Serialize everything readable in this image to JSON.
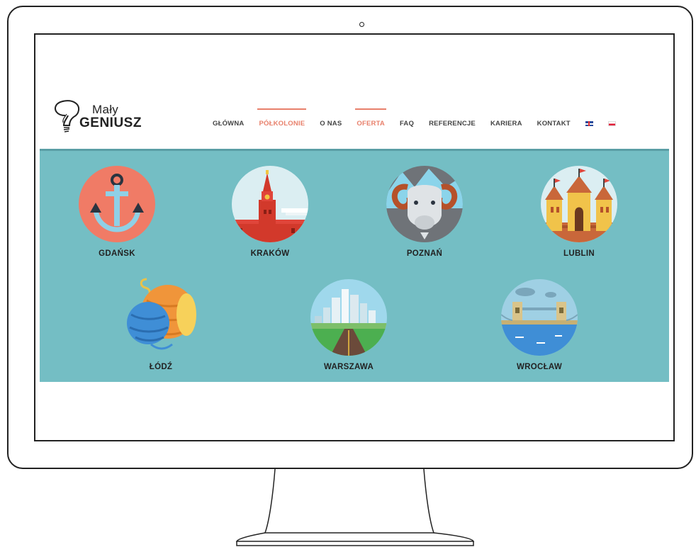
{
  "brand": {
    "logo_line1": "Mały",
    "logo_line2": "GENIUSZ"
  },
  "nav": {
    "items": [
      {
        "label": "GŁÓWNA",
        "active": false
      },
      {
        "label": "PÓŁKOLONIE",
        "active": true
      },
      {
        "label": "O NAS",
        "active": false
      },
      {
        "label": "OFERTA",
        "active": true
      },
      {
        "label": "FAQ",
        "active": false
      },
      {
        "label": "REFERENCJE",
        "active": false
      },
      {
        "label": "KARIERA",
        "active": false
      },
      {
        "label": "KONTAKT",
        "active": false
      }
    ],
    "languages": [
      "english-flag-icon",
      "polish-flag-icon"
    ]
  },
  "cities": [
    {
      "label": "GDAŃSK",
      "icon": "anchor-icon"
    },
    {
      "label": "KRAKÓW",
      "icon": "castle-tower-icon"
    },
    {
      "label": "POZNAŃ",
      "icon": "goat-icon"
    },
    {
      "label": "LUBLIN",
      "icon": "castle-icon"
    },
    {
      "label": "ŁÓDŹ",
      "icon": "yarn-balls-icon"
    },
    {
      "label": "WARSZAWA",
      "icon": "city-skyline-icon"
    },
    {
      "label": "WROCŁAW",
      "icon": "bridge-icon"
    }
  ],
  "colors": {
    "accent": "#e8806b",
    "band": "#74bec4",
    "band_border": "#5a9ea5",
    "nav_text": "#444444"
  }
}
